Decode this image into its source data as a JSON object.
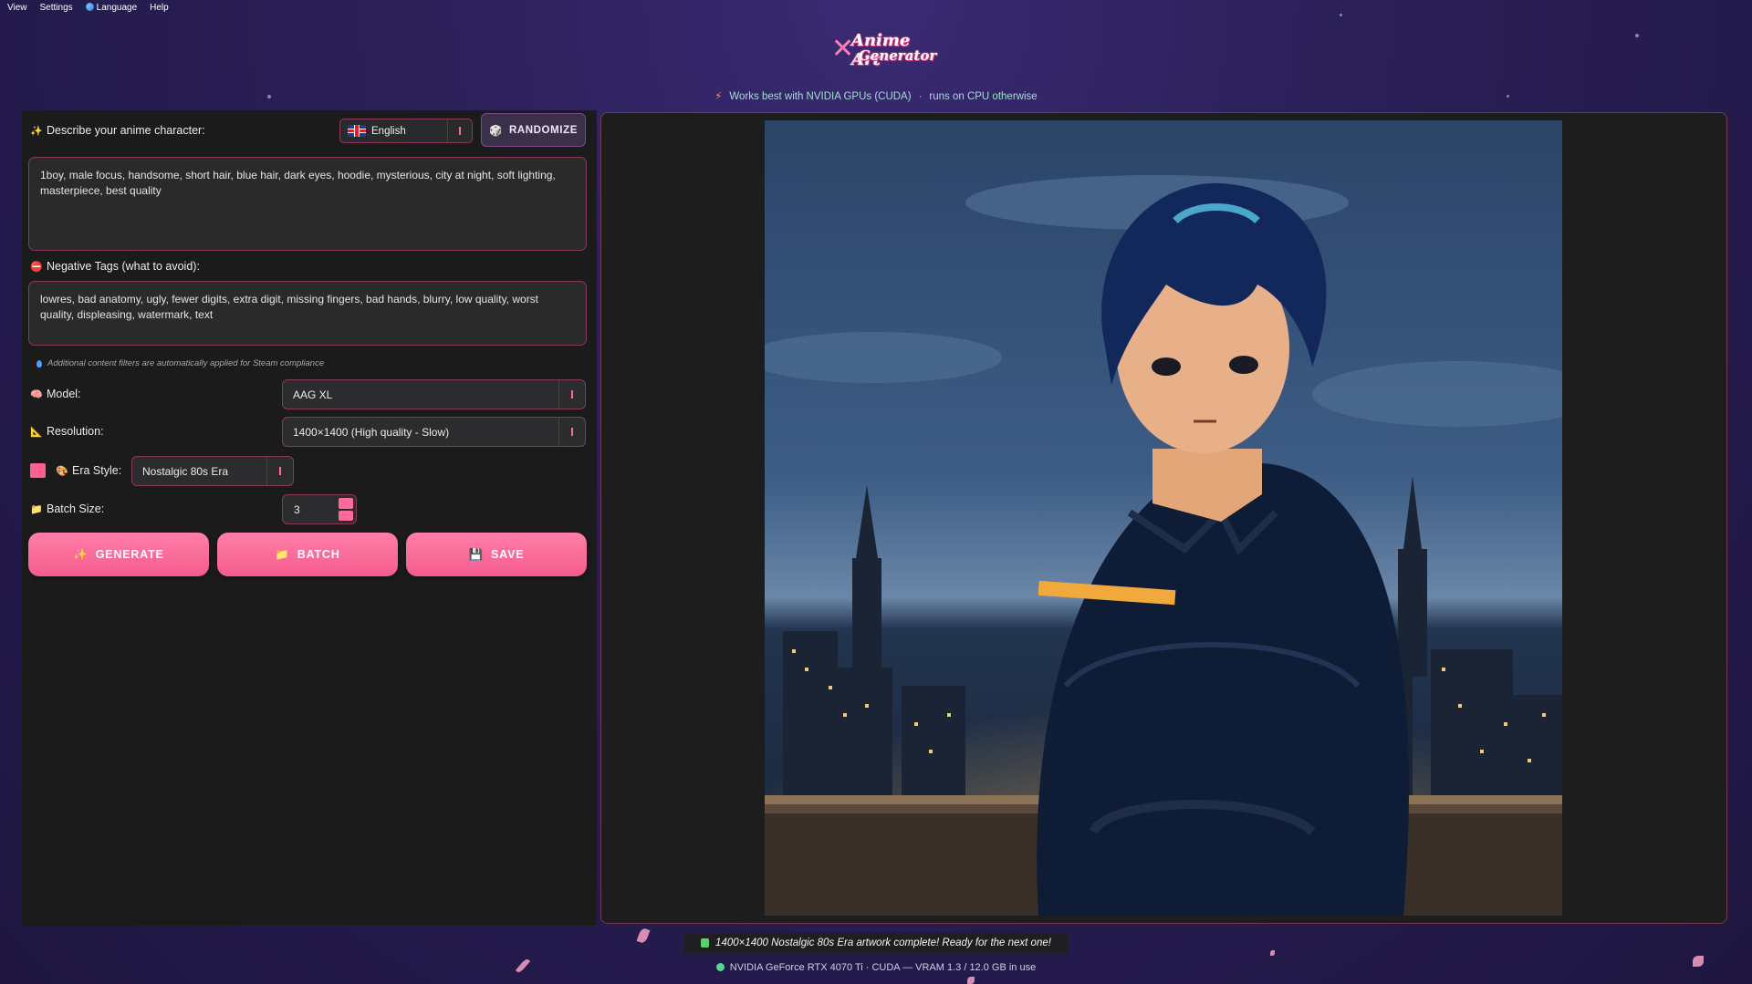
{
  "menu": [
    "View",
    "Settings",
    "Language",
    "Help"
  ],
  "app": {
    "logo_line1": "Anime Art",
    "logo_line2": "Generator"
  },
  "notice": {
    "part1": "Works best with NVIDIA GPUs (CUDA)",
    "separator": "·",
    "part2": "runs on CPU otherwise"
  },
  "prompt": {
    "label": "Describe your anime character:",
    "text": "1boy, male focus, handsome, short hair, blue hair, dark eyes, hoodie, mysterious, city at night, soft lighting, masterpiece, best quality"
  },
  "language": {
    "selected": "English"
  },
  "randomize_label": "RANDOMIZE",
  "negative": {
    "label": "Negative Tags (what to avoid):",
    "text": "lowres, bad anatomy, ugly, fewer digits, extra digit, missing fingers, bad hands, blurry, low quality, worst quality, displeasing, watermark, text"
  },
  "filter_note": "Additional content filters are automatically applied for Steam compliance",
  "model": {
    "label": "Model:",
    "value": "AAG XL"
  },
  "resolution": {
    "label": "Resolution:",
    "value": "1400×1400 (High quality - Slow)"
  },
  "era": {
    "label": "Era Style:",
    "value": "Nostalgic 80s Era",
    "swatch_color": "#ff5f8e"
  },
  "batch": {
    "label": "Batch Size:",
    "value": "3"
  },
  "buttons": {
    "generate": "GENERATE",
    "batch": "BATCH",
    "save": "SAVE"
  },
  "status": "1400×1400 Nostalgic 80s Era artwork complete! Ready for the next one!",
  "gpu_info": "NVIDIA GeForce RTX 4070 Ti · CUDA — VRAM 1.3 / 12.0 GB in use",
  "icons": {
    "sparkles": "✨",
    "no": "⛔",
    "brain": "🧠",
    "ruler": "📐",
    "palette": "🎨",
    "folder": "📁",
    "floppy": "💾",
    "dice": "🎲",
    "bolt": "⚡"
  },
  "colors": {
    "accent": "#ff6a9a",
    "panel": "#1b1b1c",
    "border": "#8a3a58"
  }
}
